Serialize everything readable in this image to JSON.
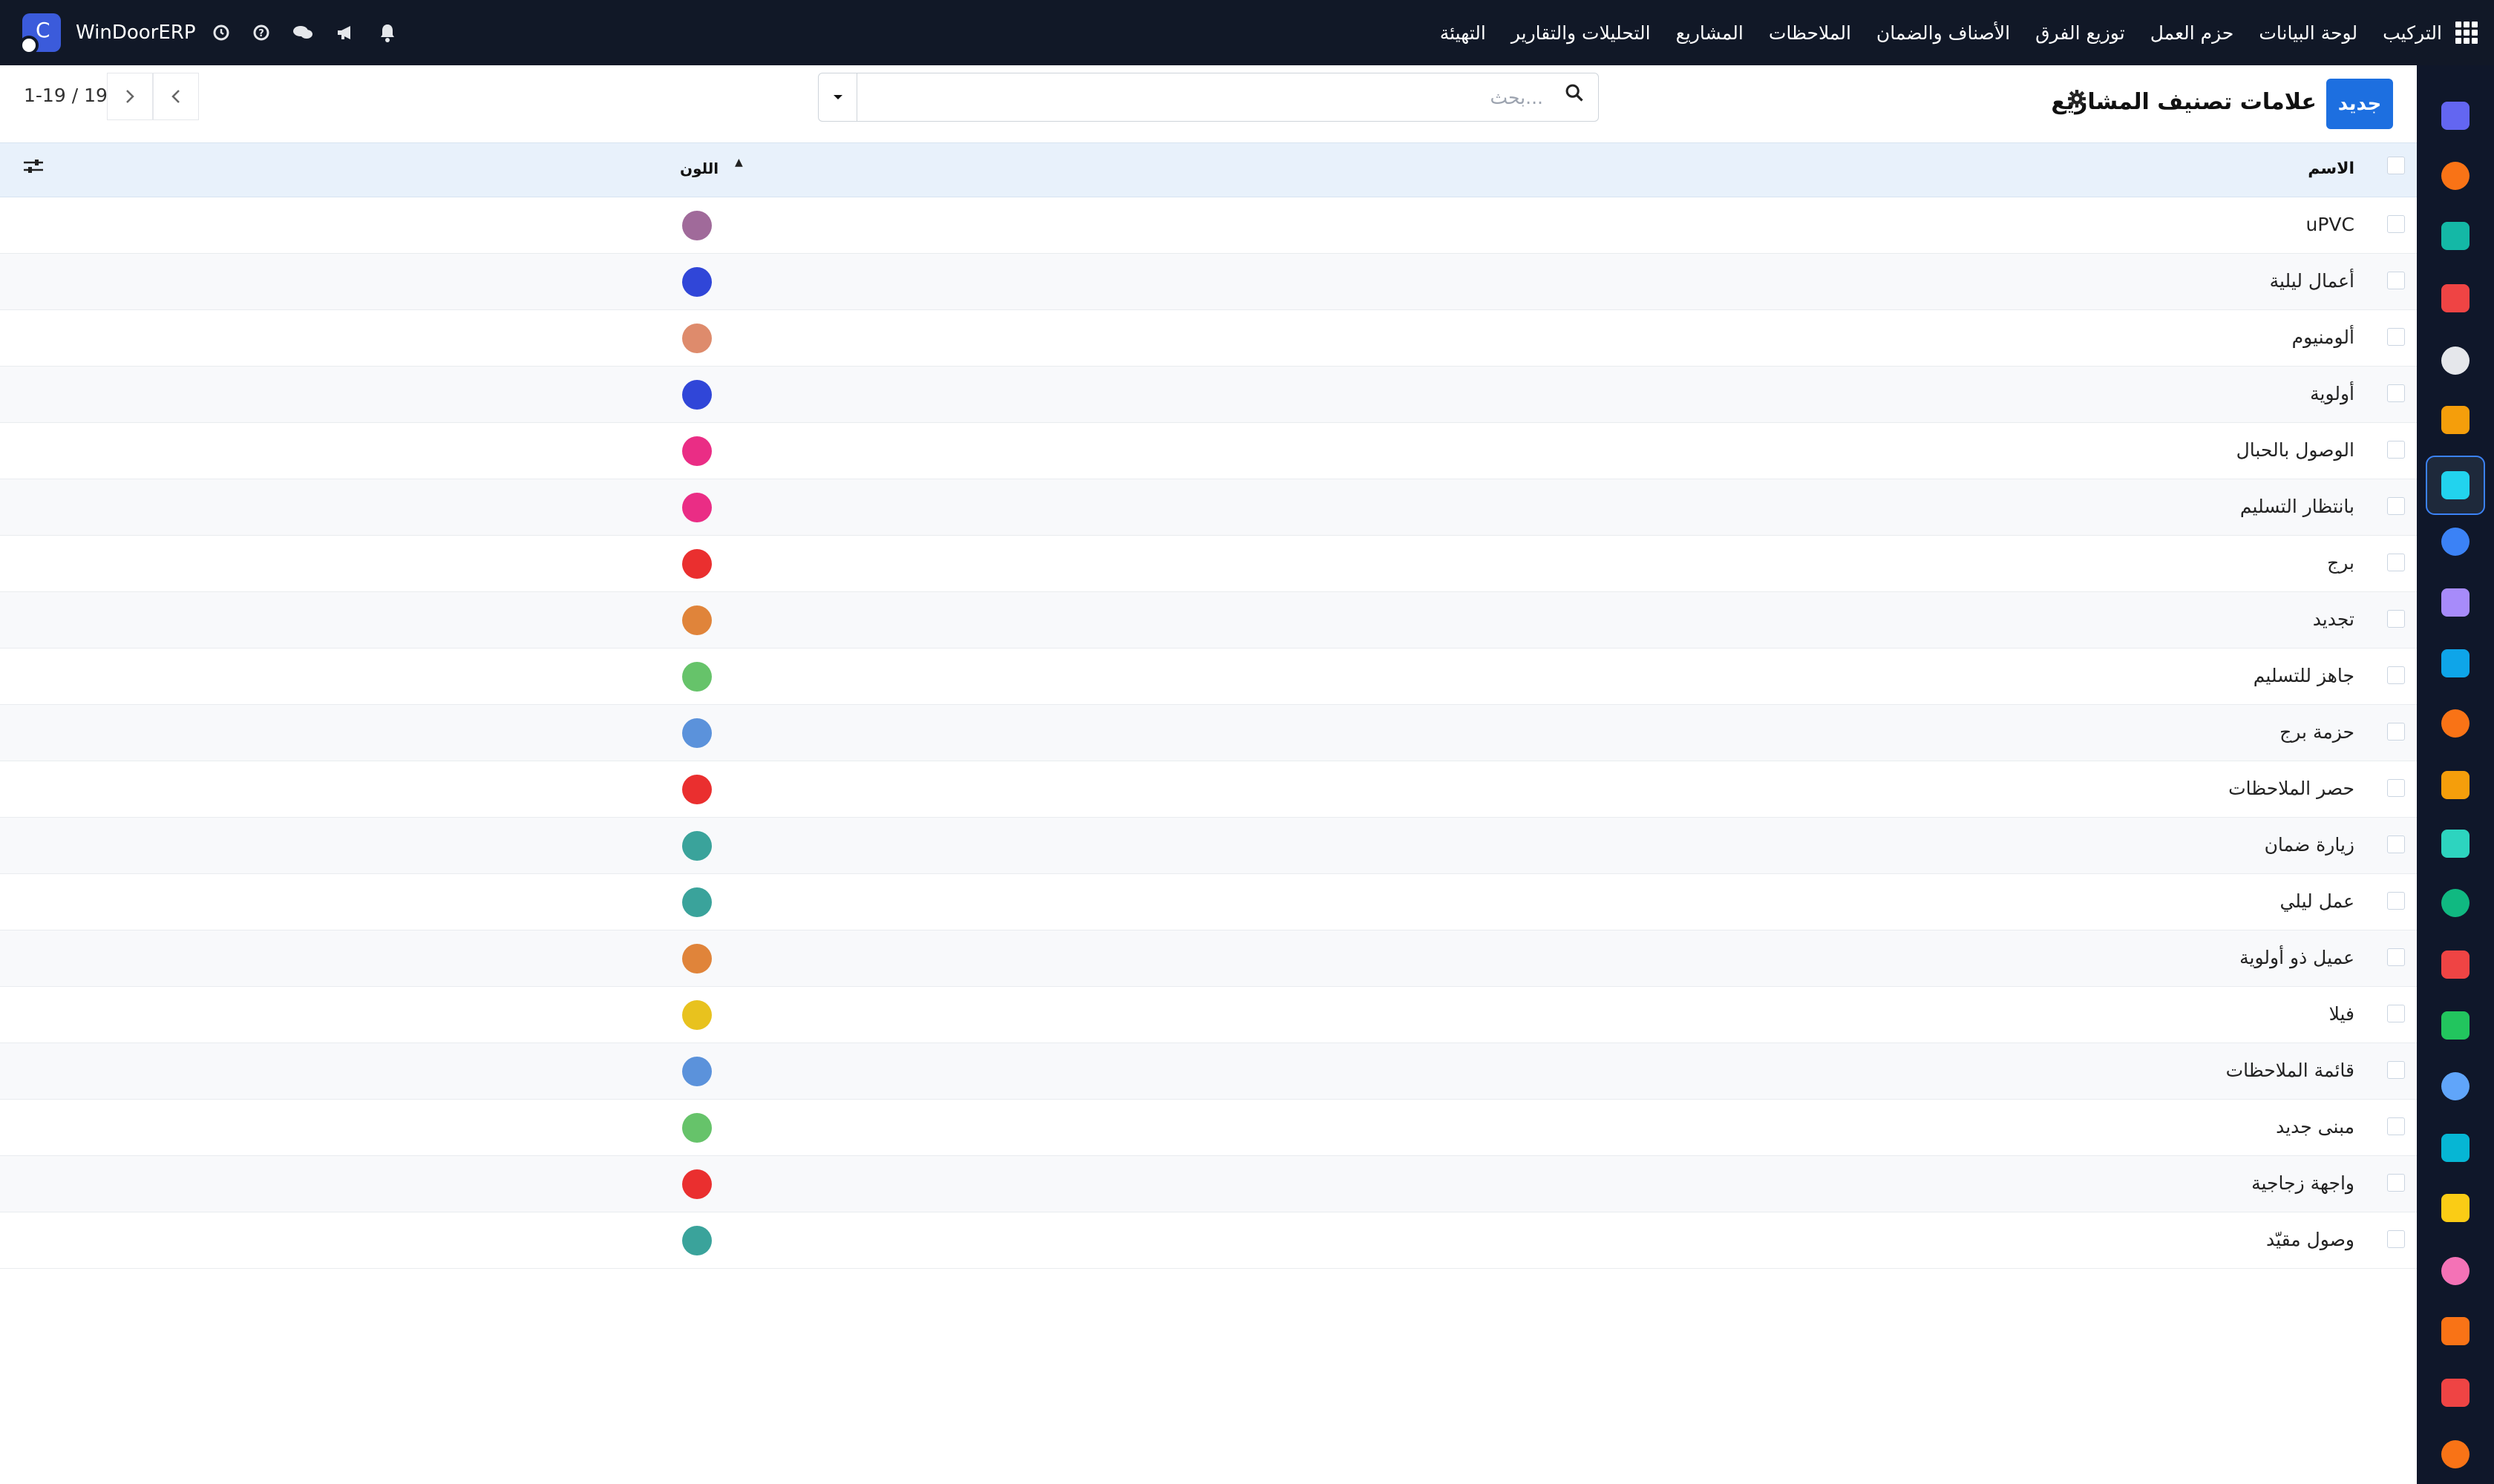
{
  "navbar": {
    "company": "WinDoorERP",
    "menu": [
      "التركيب",
      "لوحة البيانات",
      "حزم العمل",
      "توزيع الفرق",
      "الأصناف والضمان",
      "الملاحظات",
      "المشاريع",
      "التحليلات والتقارير",
      "التهيئة"
    ]
  },
  "control": {
    "new_label": "جديد",
    "title": "علامات تصنيف المشاريع",
    "search_placeholder": "بحث...",
    "pager_value": "1-19",
    "pager_total": "19",
    "pager_sep": "/"
  },
  "table": {
    "headers": {
      "name": "الاسم",
      "color": "اللون"
    },
    "rows": [
      {
        "name": "uPVC",
        "color": "#a06a9a"
      },
      {
        "name": "أعمال ليلية",
        "color": "#3046d8"
      },
      {
        "name": "ألومنيوم",
        "color": "#de8b6c"
      },
      {
        "name": "أولوية",
        "color": "#3046d8"
      },
      {
        "name": "الوصول بالحبال",
        "color": "#ea2d85"
      },
      {
        "name": "بانتظار التسليم",
        "color": "#ea2d85"
      },
      {
        "name": "برج",
        "color": "#ea2f2f"
      },
      {
        "name": "تجديد",
        "color": "#e0843a"
      },
      {
        "name": "جاهز للتسليم",
        "color": "#66c36a"
      },
      {
        "name": "حزمة برج",
        "color": "#5b92db"
      },
      {
        "name": "حصر الملاحظات",
        "color": "#ea2f2f"
      },
      {
        "name": "زيارة ضمان",
        "color": "#3aa39b"
      },
      {
        "name": "عمل ليلي",
        "color": "#3aa39b"
      },
      {
        "name": "عميل ذو أولوية",
        "color": "#e0843a"
      },
      {
        "name": "فيلا",
        "color": "#e8c21e"
      },
      {
        "name": "قائمة الملاحظات",
        "color": "#5b92db"
      },
      {
        "name": "مبنى جديد",
        "color": "#66c36a"
      },
      {
        "name": "واجهة زجاجية",
        "color": "#ea2f2f"
      },
      {
        "name": "وصول مقيّد",
        "color": "#3aa39b"
      }
    ]
  },
  "dock": {
    "apps": [
      {
        "icon": "mail-app-icon",
        "color": "#6366f1"
      },
      {
        "icon": "discuss-app-icon",
        "color": "#f97316"
      },
      {
        "icon": "crm-app-icon",
        "color": "#14b8a6"
      },
      {
        "icon": "reports-app-icon",
        "color": "#ef4444"
      },
      {
        "icon": "inventory-app-icon",
        "color": "#e5e7eb"
      },
      {
        "icon": "contacts-app-icon",
        "color": "#f59e0b"
      },
      {
        "icon": "project-app-icon",
        "color": "#22d3ee"
      },
      {
        "icon": "knowledge-app-icon",
        "color": "#3b82f6"
      },
      {
        "icon": "purchase-app-icon",
        "color": "#a78bfa"
      },
      {
        "icon": "invoicing-app-icon",
        "color": "#0ea5e9"
      },
      {
        "icon": "employees-app-icon",
        "color": "#f97316"
      },
      {
        "icon": "calendar-app-icon",
        "color": "#f59e0b"
      },
      {
        "icon": "sign-app-icon",
        "color": "#2dd4bf"
      },
      {
        "icon": "directory-app-icon",
        "color": "#10b981"
      },
      {
        "icon": "dashboards-app-icon",
        "color": "#ef4444"
      },
      {
        "icon": "whatsapp-app-icon",
        "color": "#22c55e"
      },
      {
        "icon": "timer-app-icon",
        "color": "#60a5fa"
      },
      {
        "icon": "website-app-icon",
        "color": "#06b6d4"
      },
      {
        "icon": "telegram-app-icon",
        "color": "#facc15"
      },
      {
        "icon": "payments-app-icon",
        "color": "#f472b6"
      },
      {
        "icon": "apps-store-icon",
        "color": "#f97316"
      },
      {
        "icon": "analytics-app-icon",
        "color": "#ef4444"
      },
      {
        "icon": "settings-app-icon",
        "color": "#f97316"
      }
    ]
  }
}
